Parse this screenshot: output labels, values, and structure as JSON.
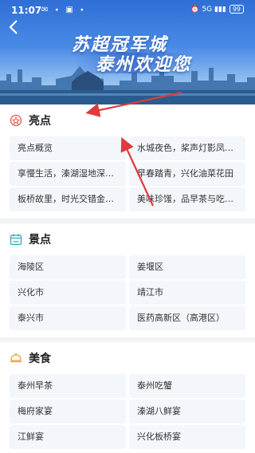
{
  "status_bar": {
    "time": "11:07",
    "left_icons": "✉ ⬩ ▣ ⬩",
    "right_icons": "⏰ 5G ▮▮▮",
    "battery": "99"
  },
  "banner": {
    "line1": "苏超冠军城",
    "line2": "泰州欢迎您"
  },
  "sections": {
    "highlights": {
      "title": "亮点",
      "items": [
        "亮点概览",
        "水城夜色，桨声灯影凤…",
        "享慢生活，溱湖湿地深…",
        "早春踏青，兴化油菜花田",
        "板桥故里，时光交错金…",
        "美味珍馐，品早茶与吃…"
      ]
    },
    "scenic": {
      "title": "景点",
      "items": [
        "海陵区",
        "姜堰区",
        "兴化市",
        "靖江市",
        "泰兴市",
        "医药高新区（高港区）"
      ]
    },
    "food": {
      "title": "美食",
      "items": [
        "泰州早茶",
        "泰州吃蟹",
        "梅府家宴",
        "溱湖八鲜宴",
        "江鲜宴",
        "兴化板桥宴"
      ]
    }
  },
  "colors": {
    "accent_red": "#e03a3a",
    "scenic_teal": "#2fa7b3",
    "food_orange": "#f0a030",
    "highlight_red": "#e05a4a",
    "grid_bg": "#f3f6fb"
  }
}
